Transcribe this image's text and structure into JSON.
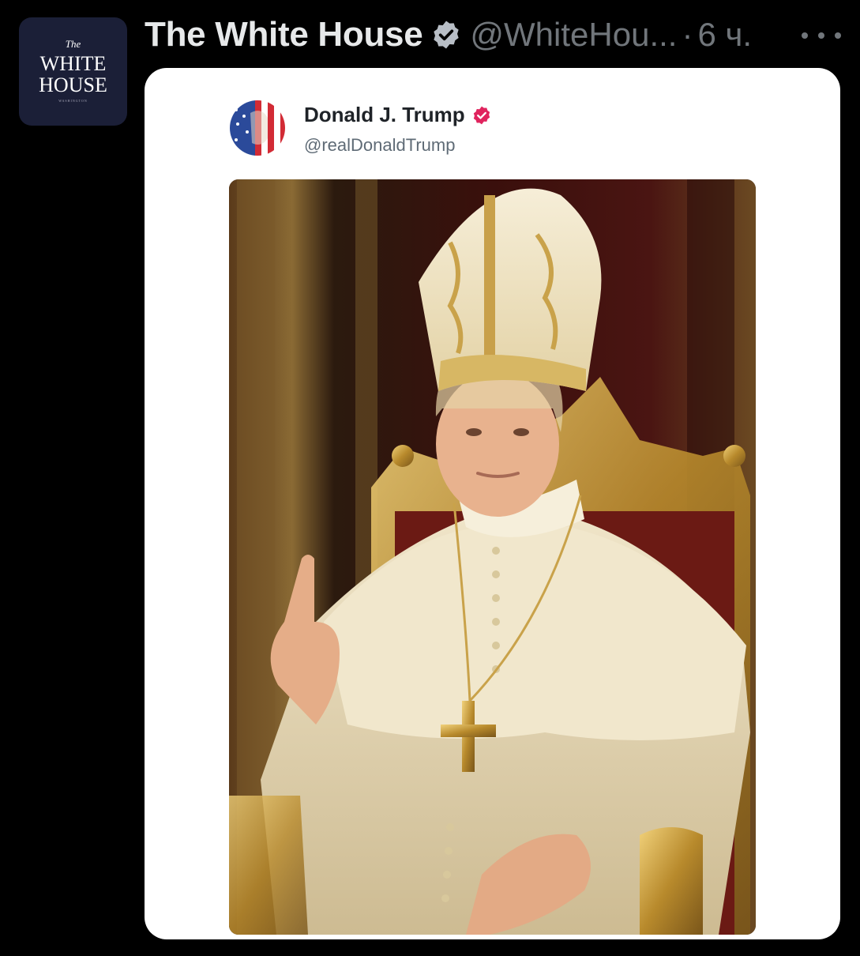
{
  "tweet": {
    "avatar": {
      "line1": "The",
      "line2": "WHITE",
      "line3": "HOUSE",
      "line4": "WASHINGTON"
    },
    "author_name": "The White House",
    "verified_icon": "verified-badge-icon",
    "handle": "@WhiteHou...",
    "separator": "·",
    "time": "6 ч.",
    "more_icon": "more-options-icon",
    "colors": {
      "background": "#000000",
      "name": "#e7e9ea",
      "meta": "#71767b",
      "badge": "#b8bec6",
      "card_bg": "#ffffff"
    }
  },
  "embedded_post": {
    "author_name": "Donald J. Trump",
    "handle": "@realDonaldTrump",
    "badge_icon": "verified-badge-icon",
    "badge_color": "#e0245e",
    "avatar_icon": "flag-portrait-avatar",
    "image": "pope-portrait-image"
  }
}
